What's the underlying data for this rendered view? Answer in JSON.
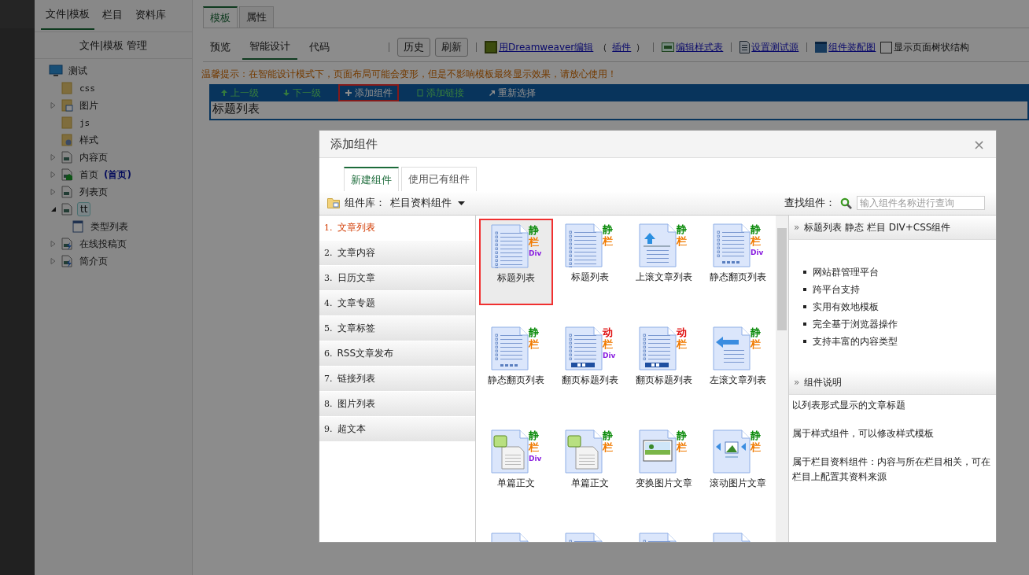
{
  "sidebar": {
    "tabs": [
      {
        "label": "文件|模板",
        "selected": true
      },
      {
        "label": "栏目",
        "selected": false
      },
      {
        "label": "资料库",
        "selected": false
      }
    ],
    "header": "文件|模板 管理",
    "tree": [
      {
        "label": "测试",
        "kind": "monitor",
        "children": [
          {
            "label": "css",
            "kind": "folder"
          },
          {
            "label": "图片",
            "kind": "image-folder",
            "expanded": false
          },
          {
            "label": "js",
            "kind": "folder"
          },
          {
            "label": "样式",
            "kind": "gear-folder"
          },
          {
            "label": "内容页",
            "kind": "page",
            "expanded": false
          },
          {
            "label": "首页",
            "tag": "(首页)",
            "kind": "home-page",
            "expanded": false
          },
          {
            "label": "列表页",
            "kind": "page",
            "expanded": false
          },
          {
            "label": "tt",
            "kind": "page",
            "expanded": true,
            "selected": true,
            "children": [
              {
                "label": "类型列表",
                "kind": "window"
              }
            ]
          },
          {
            "label": "在线投稿页",
            "kind": "bolt-page",
            "expanded": false
          },
          {
            "label": "简介页",
            "kind": "bolt-page",
            "expanded": false
          }
        ]
      }
    ]
  },
  "main": {
    "tabs": [
      {
        "label": "模板",
        "selected": true
      },
      {
        "label": "属性",
        "selected": false
      }
    ],
    "views": [
      {
        "label": "预览",
        "selected": false
      },
      {
        "label": "智能设计",
        "selected": true
      },
      {
        "label": "代码",
        "selected": false
      }
    ],
    "toolbar": [
      {
        "kind": "button",
        "label": "历史"
      },
      {
        "kind": "button",
        "label": "刷新"
      },
      {
        "kind": "sep"
      },
      {
        "kind": "dw-link",
        "label": "用Dreamweaver编辑"
      },
      {
        "kind": "text",
        "label": "（"
      },
      {
        "kind": "link",
        "label": "插件"
      },
      {
        "kind": "text",
        "label": "）"
      },
      {
        "kind": "sep"
      },
      {
        "kind": "css-link",
        "label": "编辑样式表"
      },
      {
        "kind": "sep"
      },
      {
        "kind": "doc-link",
        "label": "设置测试源"
      },
      {
        "kind": "sep"
      },
      {
        "kind": "window-link",
        "label": "组件装配图"
      },
      {
        "kind": "checkbox",
        "label": "显示页面树状结构",
        "checked": false
      }
    ],
    "tip": "温馨提示：在智能设计模式下，页面布局可能会变形，但是不影响模板最终显示效果，请放心使用！",
    "actions": [
      {
        "label": "上一级",
        "kind": "up",
        "disabled": true,
        "highlighted": false
      },
      {
        "label": "下一级",
        "kind": "down",
        "disabled": true,
        "highlighted": false
      },
      {
        "label": "添加组件",
        "kind": "plus",
        "disabled": false,
        "highlighted": true
      },
      {
        "label": "添加链接",
        "kind": "link",
        "disabled": true,
        "highlighted": false
      },
      {
        "label": "重新选择",
        "kind": "return",
        "disabled": false,
        "highlighted": false
      }
    ],
    "selected_element": "标题列表"
  },
  "dialog": {
    "title": "添加组件",
    "close": "×",
    "tabs": [
      {
        "label": "新建组件",
        "selected": true
      },
      {
        "label": "使用已有组件",
        "selected": false
      }
    ],
    "library_label": "组件库：",
    "library_value": "栏目资料组件",
    "search_label": "查找组件：",
    "search_placeholder": "输入组件名称进行查询",
    "categories": [
      {
        "num": "1.",
        "label": "文章列表",
        "selected": true
      },
      {
        "num": "2.",
        "label": "文章内容",
        "selected": false
      },
      {
        "num": "3.",
        "label": "日历文章",
        "selected": false
      },
      {
        "num": "4.",
        "label": "文章专题",
        "selected": false
      },
      {
        "num": "5.",
        "label": "文章标签",
        "selected": false
      },
      {
        "num": "6.",
        "label": "RSS文章发布",
        "selected": false
      },
      {
        "num": "7.",
        "label": "链接列表",
        "selected": false
      },
      {
        "num": "8.",
        "label": "图片列表",
        "selected": false
      },
      {
        "num": "9.",
        "label": "超文本",
        "selected": false
      }
    ],
    "components": [
      {
        "label": "标题列表",
        "kind": "list",
        "mode": "静",
        "column": "栏",
        "div": "Div",
        "selected": true,
        "highlighted": true
      },
      {
        "label": "标题列表",
        "kind": "list",
        "mode": "静",
        "column": "栏",
        "selected": false,
        "highlighted": false
      },
      {
        "label": "上滚文章列表",
        "kind": "up-scroll",
        "mode": "静",
        "column": "栏",
        "selected": false,
        "highlighted": false
      },
      {
        "label": "静态翻页列表",
        "kind": "paged",
        "mode": "静",
        "column": "栏",
        "div": "Div",
        "selected": false,
        "highlighted": false
      },
      {
        "label": "静态翻页列表",
        "kind": "paged",
        "mode": "静",
        "column": "栏",
        "selected": false,
        "highlighted": false
      },
      {
        "label": "翻页标题列表",
        "kind": "pager",
        "mode": "动",
        "column": "栏",
        "div": "Div",
        "selected": false,
        "highlighted": false
      },
      {
        "label": "翻页标题列表",
        "kind": "pager",
        "mode": "动",
        "column": "栏",
        "selected": false,
        "highlighted": false
      },
      {
        "label": "左滚文章列表",
        "kind": "left-scroll",
        "mode": "静",
        "column": "栏",
        "selected": false,
        "highlighted": false
      },
      {
        "label": "单篇正文",
        "kind": "article",
        "mode": "静",
        "column": "栏",
        "div": "Div",
        "selected": false,
        "highlighted": false
      },
      {
        "label": "单篇正文",
        "kind": "article",
        "mode": "静",
        "column": "栏",
        "selected": false,
        "highlighted": false
      },
      {
        "label": "变换图片文章",
        "kind": "picture",
        "mode": "静",
        "column": "栏",
        "selected": false,
        "highlighted": false
      },
      {
        "label": "滚动图片文章",
        "kind": "picture-scroll",
        "mode": "静",
        "column": "栏",
        "selected": false,
        "highlighted": false
      },
      {
        "kind": "photo",
        "selected": false,
        "highlighted": false
      },
      {
        "kind": "list",
        "selected": false,
        "highlighted": false
      },
      {
        "kind": "list",
        "selected": false,
        "highlighted": false
      },
      {
        "kind": "picture",
        "selected": false,
        "highlighted": false
      }
    ],
    "info_chevron": "»",
    "info_title": "标题列表 静态 栏目 DIV+CSS组件",
    "features": [
      "网站群管理平台",
      "跨平台支持",
      "实用有效地模板",
      "完全基于浏览器操作",
      "支持丰富的内容类型"
    ],
    "desc_chevron": "»",
    "desc_title": "组件说明",
    "description": [
      "以列表形式显示的文章标题",
      "属于样式组件，可以修改样式模板",
      "属于栏目资料组件：内容与所在栏目相关，可在栏目上配置其资料来源"
    ]
  }
}
